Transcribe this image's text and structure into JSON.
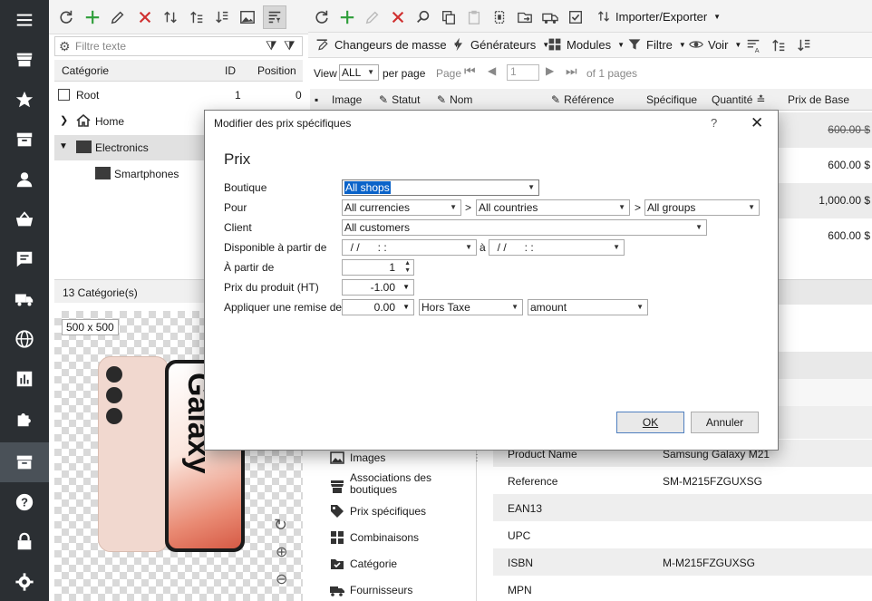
{
  "left_toolbar": {
    "filter_placeholder": "Filtre texte"
  },
  "category_tree": {
    "columns": [
      "Catégorie",
      "ID",
      "Position"
    ],
    "rows": [
      {
        "label": "Root",
        "id": "1",
        "position": "0"
      },
      {
        "label": "Home",
        "id": "",
        "position": ""
      },
      {
        "label": "Electronics",
        "id": "",
        "position": ""
      },
      {
        "label": "Smartphones",
        "id": "",
        "position": ""
      }
    ],
    "footer": "13 Catégorie(s)"
  },
  "main_toolbar": {
    "import_export": "Importer/Exporter",
    "mass_changers": "Changeurs de masse",
    "generators": "Générateurs",
    "modules": "Modules",
    "filter": "Filtre",
    "view": "Voir"
  },
  "pager": {
    "view_label": "View",
    "view_value": "ALL",
    "per_page": "per page",
    "page_label": "Page",
    "page_value": "1",
    "of_pages": "of 1 pages"
  },
  "grid": {
    "columns": [
      "Image",
      "Statut",
      "Nom",
      "Référence",
      "Spécifique",
      "Quantité",
      "Prix de Base"
    ],
    "prices": [
      "600.00 $",
      "600.00 $",
      "1,000.00 $",
      "600.00 $"
    ]
  },
  "image_panel": {
    "size_label": "500 x 500",
    "phone_brand": "Galaxy"
  },
  "side_menu": {
    "items": [
      "Images",
      "Associations des boutiques",
      "Prix spécifiques",
      "Combinaisons",
      "Catégorie",
      "Fournisseurs"
    ]
  },
  "properties": [
    {
      "key": "Product Name",
      "value": "Samsung Galaxy M21"
    },
    {
      "key": "Reference",
      "value": "SM-M215FZGUXSG"
    },
    {
      "key": "EAN13",
      "value": ""
    },
    {
      "key": "UPC",
      "value": ""
    },
    {
      "key": "ISBN",
      "value": "M-M215FZGUXSG"
    },
    {
      "key": "MPN",
      "value": ""
    }
  ],
  "dialog": {
    "title": "Modifier des prix spécifiques",
    "help": "?",
    "close": "✕",
    "heading": "Prix",
    "labels": {
      "shop": "Boutique",
      "for": "Pour",
      "client": "Client",
      "available_from": "Disponible à partir de",
      "from_qty": "À partir de",
      "product_price": "Prix du produit (HT)",
      "apply_discount": "Appliquer une remise de"
    },
    "shop_value": "All shops",
    "currency_value": "All currencies",
    "country_value": "All countries",
    "group_value": "All groups",
    "gt": ">",
    "client_value": "All customers",
    "date_from": "  / /      : :",
    "date_to_sep": "à",
    "date_to": "  / /      : :",
    "from_qty_value": "1",
    "price_value": "-1.00",
    "discount_value": "0.00",
    "tax_value": "Hors Taxe",
    "reduction_type": "amount",
    "ok": "OK",
    "cancel": "Annuler"
  }
}
